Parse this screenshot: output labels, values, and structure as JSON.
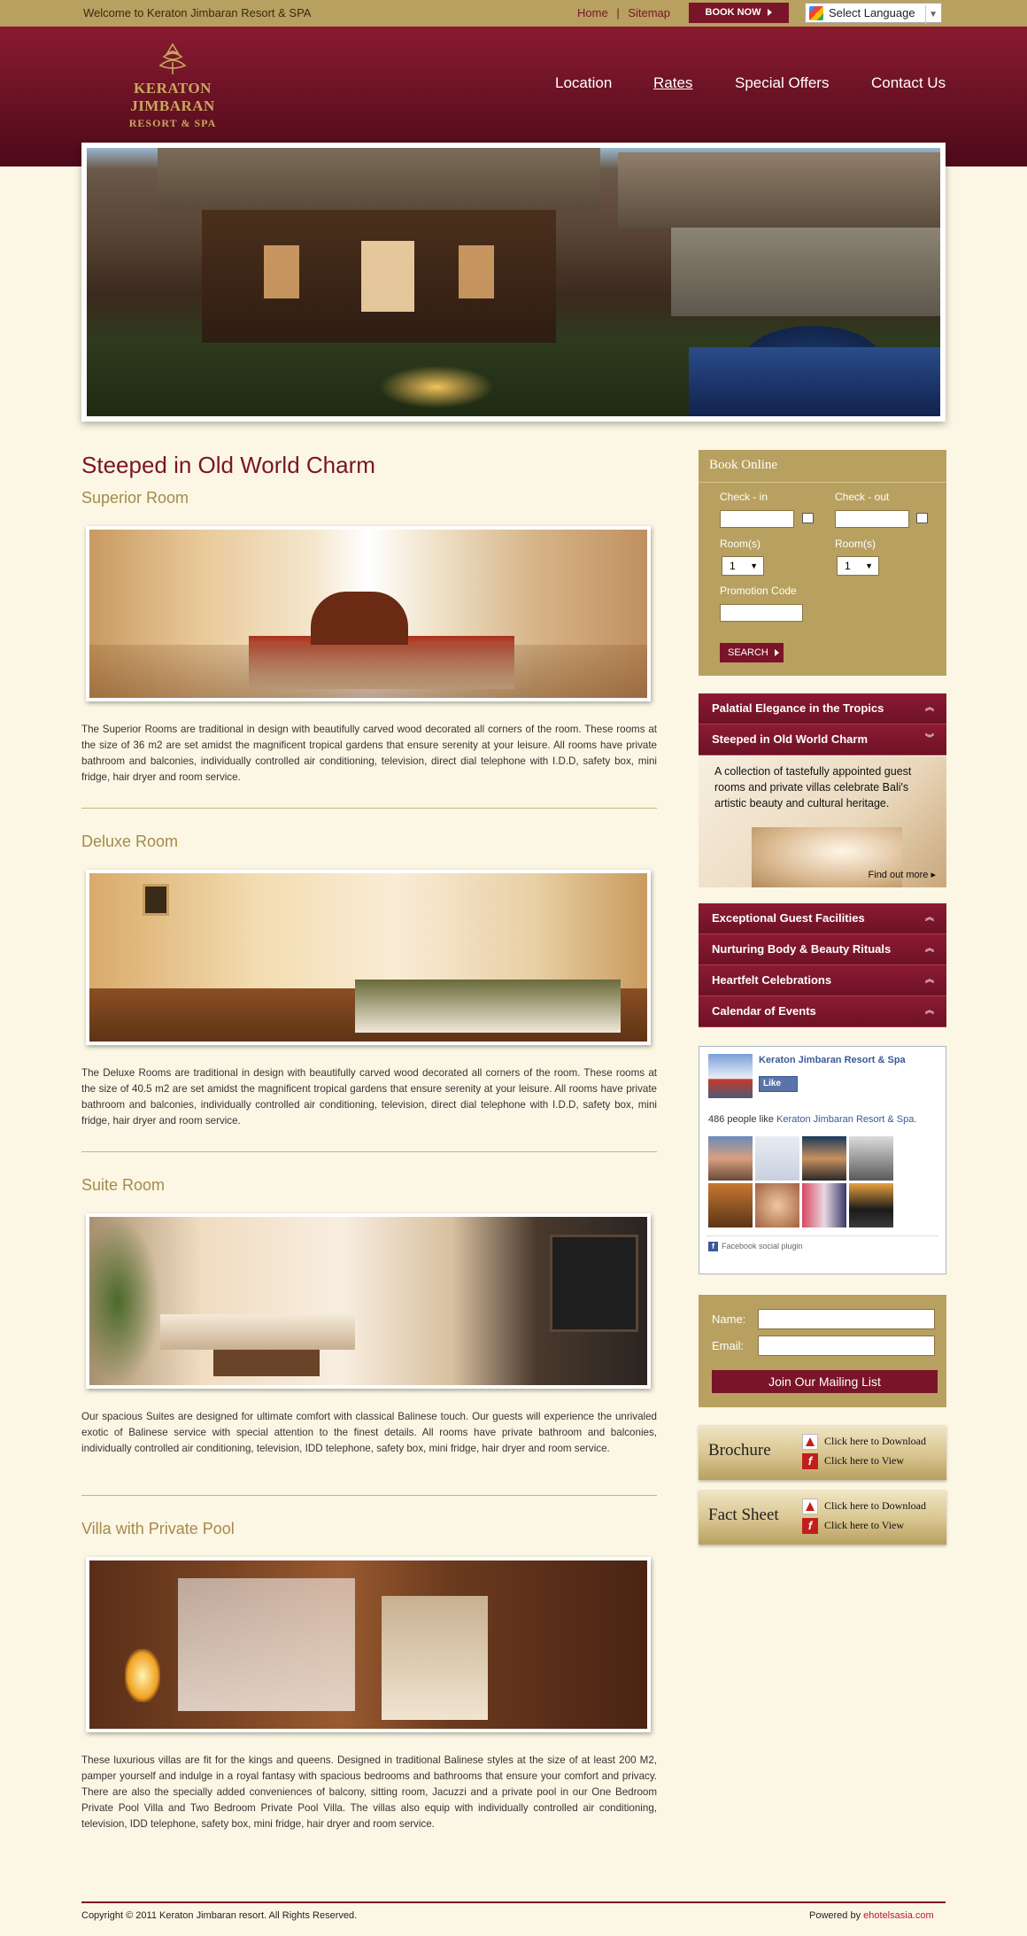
{
  "topbar": {
    "welcome": "Welcome to Keraton Jimbaran Resort & SPA",
    "home": "Home",
    "sep": "|",
    "sitemap": "Sitemap",
    "book_now": "BOOK NOW",
    "language": "Select Language"
  },
  "logo": {
    "line1": "KERATON JIMBARAN",
    "line2": "RESORT & SPA"
  },
  "nav": [
    "Location",
    "Rates",
    "Special Offers",
    "Contact Us"
  ],
  "main": {
    "title": "Steeped in Old World Charm",
    "rooms": [
      {
        "name": "Superior Room",
        "desc": "The Superior Rooms are traditional in design with beautifully carved wood decorated all corners of the room. These rooms at the size of 36 m2 are set amidst the magnificent tropical gardens that ensure serenity at your leisure. All rooms have private bathroom and balconies, individually controlled air conditioning, television, direct dial telephone with I.D.D, safety box, mini fridge, hair dryer and room service."
      },
      {
        "name": "Deluxe Room",
        "desc": "The Deluxe Rooms are traditional in design with beautifully carved wood decorated all corners of the room. These rooms at the size of 40.5 m2 are set amidst the magnificent tropical gardens that ensure serenity at your leisure. All rooms have private bathroom and balconies, individually controlled air conditioning, television, direct dial telephone with I.D.D, safety box, mini fridge, hair dryer and room service."
      },
      {
        "name": "Suite Room",
        "desc": "Our spacious Suites are designed for ultimate comfort with classical Balinese touch. Our guests will experience the unrivaled exotic of Balinese service with special attention to the finest details. All rooms have private bathroom and balconies, individually controlled air conditioning, television, IDD telephone, safety box, mini fridge, hair dryer and room service."
      },
      {
        "name": "Villa with Private Pool",
        "desc": "These luxurious villas are fit for the kings and queens. Designed in traditional Balinese styles at the size of at least 200 M2, pamper yourself and indulge in a royal fantasy with spacious bedrooms and bathrooms that ensure your comfort and privacy. There are also the specially added conveniences of balcony, sitting room, Jacuzzi and a private pool in our One Bedroom Private Pool Villa and Two Bedroom Private Pool Villa. The villas also equip with individually controlled air conditioning, television, IDD telephone, safety box, mini fridge, hair dryer and room service."
      }
    ]
  },
  "booking": {
    "title": "Book Online",
    "checkin": "Check - in",
    "checkout": "Check - out",
    "rooms1": "Room(s)",
    "rooms2": "Room(s)",
    "rooms1_value": "1",
    "rooms2_value": "1",
    "promo": "Promotion Code",
    "search": "SEARCH"
  },
  "accordion": {
    "items": [
      "Palatial Elegance in the Tropics",
      "Steeped in Old World Charm",
      "Exceptional Guest Facilities",
      "Nurturing Body & Beauty Rituals",
      "Heartfelt Celebrations",
      "Calendar of Events"
    ],
    "panel_text": "A collection of tastefully appointed guest rooms and private villas celebrate Bali's artistic beauty and cultural heritage.",
    "find_out": "Find out more"
  },
  "facebook": {
    "page_name": "Keraton Jimbaran Resort & Spa",
    "like": "Like",
    "count_text": "486 people like",
    "count_link": "Keraton Jimbaran Resort & Spa.",
    "plugin": "Facebook social plugin"
  },
  "mailing": {
    "name_label": "Name:",
    "email_label": "Email:",
    "button": "Join Our Mailing List"
  },
  "downloads": [
    {
      "title": "Brochure",
      "download": "Click here to Download",
      "view": "Click here to View"
    },
    {
      "title": "Fact Sheet",
      "download": "Click here to Download",
      "view": "Click here to View"
    }
  ],
  "footer": {
    "copyright": "Copyright © 2011 Keraton Jimbaran resort. All Rights Reserved.",
    "powered_by": "Powered by",
    "powered_link": "ehotelsasia.com"
  },
  "colors": {
    "maroon": "#7a1428",
    "gold": "#b8a060",
    "cream": "#fcf7e4"
  }
}
